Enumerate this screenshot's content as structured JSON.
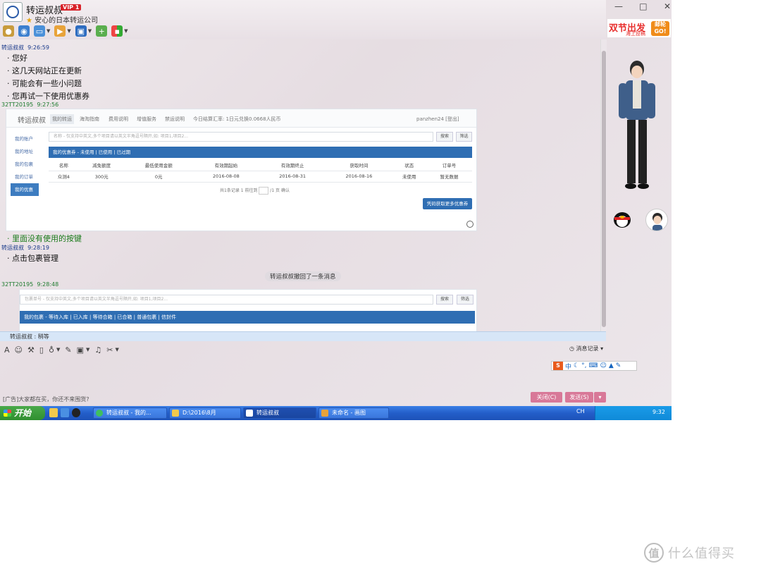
{
  "header": {
    "contact_name": "转运叔叔",
    "vip_badge": "VIP 1",
    "signature": "安心的日本转运公司",
    "window_controls": [
      "—",
      "□",
      "✕"
    ]
  },
  "chat": {
    "messages": [
      {
        "sender": "转运叔叔",
        "time": "9:26:59",
        "lines": [
          "您好",
          "这几天网站正在更新",
          "可能会有一些小问题",
          "您再试一下使用优惠券"
        ]
      },
      {
        "sender": "32TT20195",
        "time": "9:27:56",
        "lines": [
          "里面没有使用的按键"
        ]
      },
      {
        "sender": "转运叔叔",
        "time": "9:28:19",
        "lines": [
          "点击包裹管理"
        ]
      },
      {
        "sender": "32TT20195",
        "time": "9:28:48",
        "lines": []
      }
    ],
    "recall_notice": "转运叔叔撤回了一条消息"
  },
  "shot1": {
    "logo": "转运叔叔",
    "nav": [
      "我的转运",
      "海淘指南",
      "费用说明",
      "增值服务",
      "禁运说明",
      "今日结算汇率: 1日元兑换0.0668人民币"
    ],
    "user": "panzhen24 [登出]",
    "sidebar": [
      "我的账户",
      "我的地址",
      "我的包裹",
      "我的订单",
      "我的优惠"
    ],
    "search_placeholder": "名称 - 仅支持中英文,多个项目请以英文半角逗号隔开,如: 项目1,项目2...",
    "search_btn": "搜索",
    "filter_btn": "筛选",
    "tab_bar": "我的优惠券 - 未使用 | 已使用 | 已过期",
    "columns": [
      "名称",
      "减免额度",
      "最低使用金额",
      "有效期起始",
      "有效期终止",
      "获取时间",
      "状态",
      "订单号"
    ],
    "row": [
      "众测4",
      "300元",
      "0元",
      "2016-08-08",
      "2016-08-31",
      "2016-08-16",
      "未使用",
      "暂无数据"
    ],
    "pager": "共1条记录  1  前往到",
    "pager_tail": "/1 页 确认",
    "more_btn": "凭码获取更多优惠券"
  },
  "shot2": {
    "search_placeholder": "包裹单号 - 仅支持中英文,多个项目请以英文半角逗号隔开,如: 项目1,项目2...",
    "search_btn": "搜索",
    "filter_btn": "筛选",
    "tab_bar": "我的包裹 - 等待入库 | 已入库 | 等待合箱 | 已合箱 | 普通包裹 | 信封件"
  },
  "status_bar": "转运叔叔 : 稍等",
  "input": {
    "history": "消息记录",
    "ad": "[广告]大家都在买，你还不来围货?",
    "close_btn": "关闭(C)",
    "send_btn": "发送(S)"
  },
  "ime_label": "中",
  "promo": {
    "big": "双节出发",
    "small": "海上投稿",
    "go": "邮轮GO!"
  },
  "taskbar": {
    "start": "开始",
    "tasks": [
      "转运叔叔 - 我的...",
      "D:\\2016\\8月",
      "转运叔叔",
      "未命名 - 画图"
    ],
    "clock": "9:32",
    "ime": "CH"
  },
  "watermark": "什么值得买",
  "colors": {
    "accent_blue": "#2f6eb3",
    "chat_name": "#1a3a8a",
    "taskbar": "#235ec9",
    "button_pink": "#d87898"
  }
}
